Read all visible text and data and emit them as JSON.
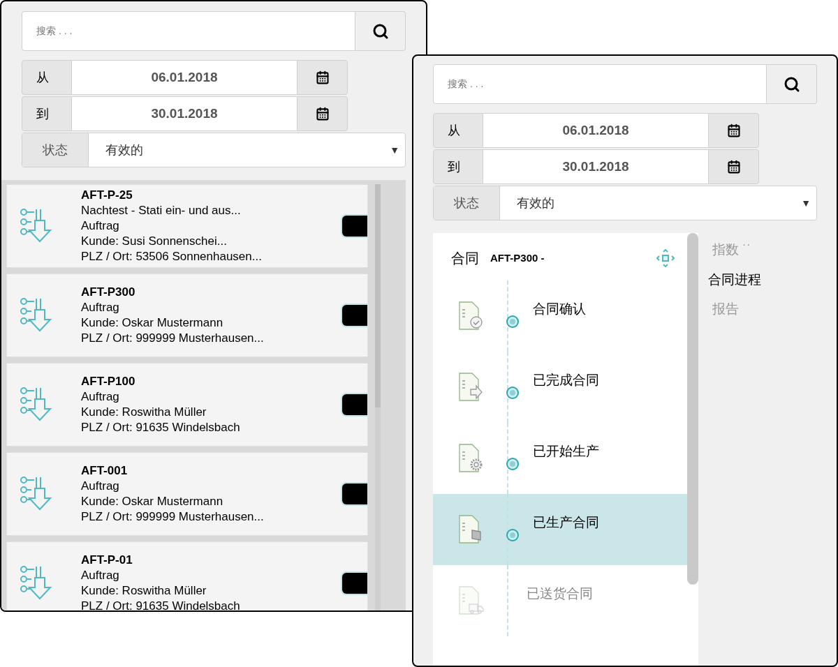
{
  "left_window": {
    "search": {
      "placeholder": "搜索 . . ."
    },
    "date_from": {
      "label": "从",
      "value": "06.01.2018"
    },
    "date_to": {
      "label": "到",
      "value": "30.01.2018"
    },
    "status": {
      "label": "状态",
      "value": "有效的",
      "caret": "▼"
    },
    "orders": [
      {
        "id": "AFT-P-25",
        "lines": [
          "Nachtest - Stati ein- und aus...",
          "Auftrag",
          "Kunde: Susi Sonnenschei...",
          "PLZ / Ort: 53506 Sonnenhausen..."
        ]
      },
      {
        "id": "AFT-P300",
        "lines": [
          "Auftrag",
          "Kunde: Oskar Mustermann",
          "PLZ / Ort: 999999 Musterhausen..."
        ]
      },
      {
        "id": "AFT-P100",
        "lines": [
          "Auftrag",
          "Kunde: Roswitha Müller",
          "PLZ / Ort: 91635 Windelsbach"
        ]
      },
      {
        "id": "AFT-001",
        "lines": [
          "Auftrag",
          "Kunde: Oskar Mustermann",
          "PLZ / Ort: 999999 Musterhausen..."
        ]
      },
      {
        "id": "AFT-P-01",
        "lines": [
          "Auftrag",
          "Kunde: Roswitha Müller",
          "PLZ / Ort: 91635 Windelsbach"
        ]
      }
    ]
  },
  "right_window": {
    "search": {
      "placeholder": "搜索 . . ."
    },
    "date_from": {
      "label": "从",
      "value": "06.01.2018"
    },
    "date_to": {
      "label": "到",
      "value": "30.01.2018"
    },
    "status": {
      "label": "状态",
      "value": "有效的",
      "caret": "▼"
    },
    "contract": {
      "label": "合同",
      "number": "AFT-P300 -"
    },
    "steps": [
      {
        "label": "合同确认",
        "kind": "check",
        "selected": false,
        "disabled": false
      },
      {
        "label": "已完成合同",
        "kind": "arrow",
        "selected": false,
        "disabled": false
      },
      {
        "label": "已开始生产",
        "kind": "gear",
        "selected": false,
        "disabled": false
      },
      {
        "label": "已生产合同",
        "kind": "flag",
        "selected": true,
        "disabled": false
      },
      {
        "label": "已送货合同",
        "kind": "truck",
        "selected": false,
        "disabled": true
      }
    ],
    "tabs": [
      {
        "label": "指数 ˙˙",
        "selected": false
      },
      {
        "label": "合同进程",
        "selected": true
      },
      {
        "label": "报告",
        "selected": false
      }
    ]
  }
}
